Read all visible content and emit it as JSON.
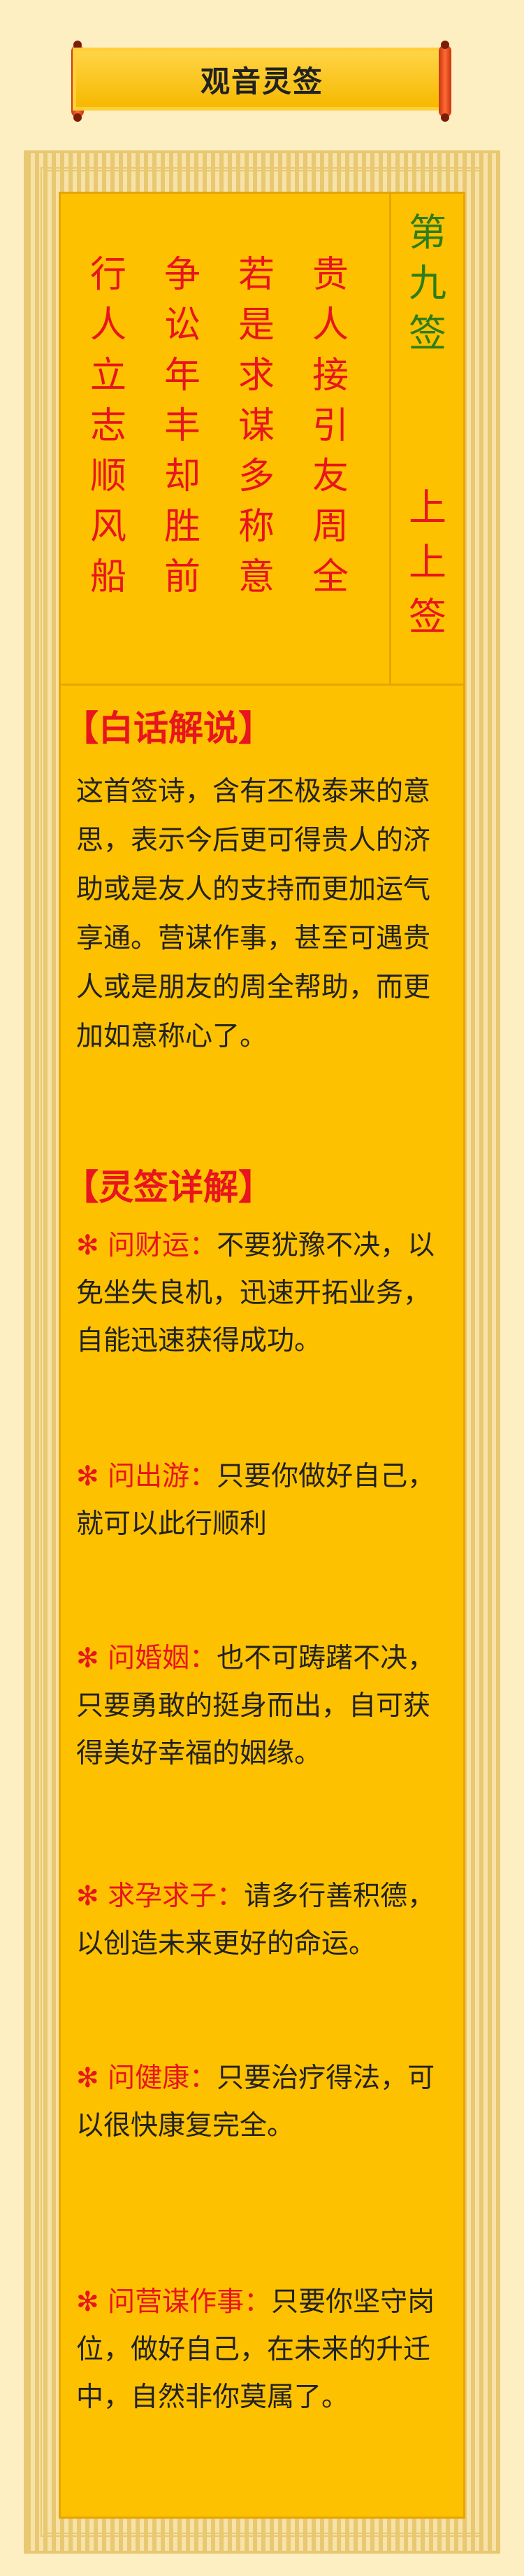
{
  "title": "观音灵签",
  "sign_number": [
    "第",
    "九",
    "签"
  ],
  "sign_grade": [
    "上",
    "上",
    "签"
  ],
  "poem_columns": [
    [
      "贵",
      "人",
      "接",
      "引",
      "友",
      "周",
      "全"
    ],
    [
      "若",
      "是",
      "求",
      "谋",
      "多",
      "称",
      "意"
    ],
    [
      "争",
      "讼",
      "年",
      "丰",
      "却",
      "胜",
      "前"
    ],
    [
      "行",
      "人",
      "立",
      "志",
      "顺",
      "风",
      "船"
    ]
  ],
  "section1": {
    "heading": "【白话解说】",
    "text": "这首签诗，含有丕极泰来的意思，表示今后更可得贵人的济助或是友人的支持而更加运气享通。营谋作事，甚至可遇贵人或是朋友的周全帮助，而更加如意称心了。"
  },
  "section2": {
    "heading": "【灵签详解】",
    "items": [
      {
        "label": "✻ 问财运：",
        "text": "不要犹豫不决，以免坐失良机，迅速开拓业务，自能迅速获得成功。"
      },
      {
        "label": "✻ 问出游：",
        "text": "只要你做好自己，就可以此行顺利"
      },
      {
        "label": "✻ 问婚姻：",
        "text": "也不可踌躇不决，只要勇敢的挺身而出，自可获得美好幸福的姻缘。"
      },
      {
        "label": "✻ 求孕求子：",
        "text": "请多行善积德，以创造未来更好的命运。"
      },
      {
        "label": "✻ 问健康：",
        "text": "只要治疗得法，可以很快康复完全。"
      },
      {
        "label": "✻ 问营谋作事：",
        "text": "只要你坚守岗位，做好自己，在未来的升迁中，自然非你莫属了。"
      }
    ]
  }
}
